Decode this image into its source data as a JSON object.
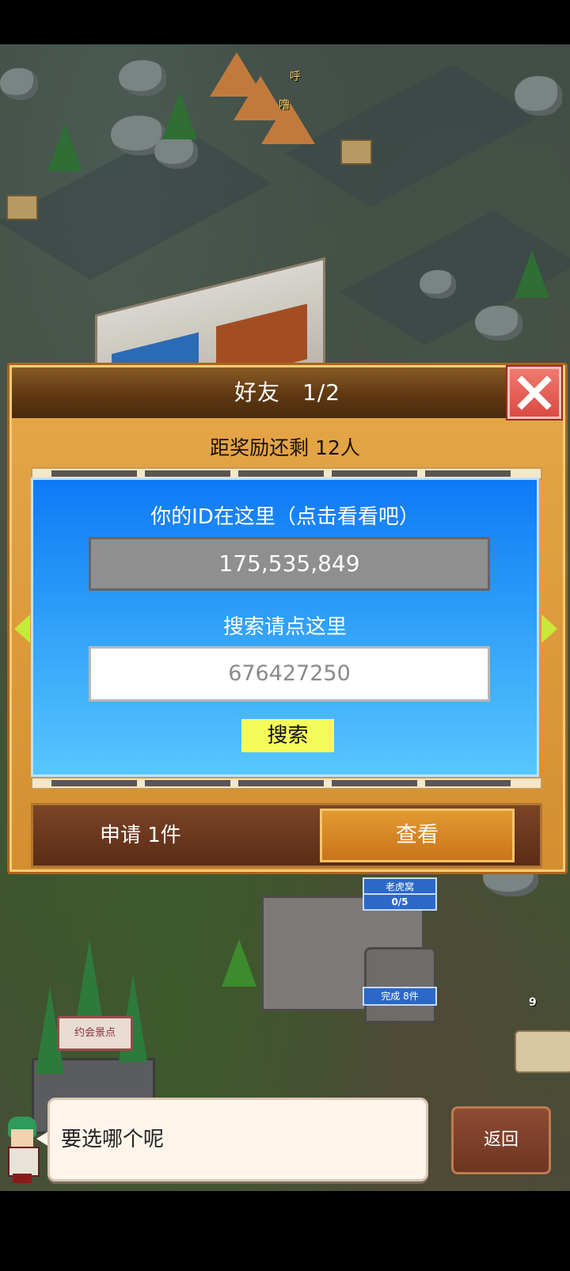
{
  "dialog": {
    "title": "好友",
    "page_indicator": "1/2",
    "reward_text": "距奖励还剩 12人",
    "id_label": "你的ID在这里（点击看看吧）",
    "player_id": "175,535,849",
    "search_label": "搜索请点这里",
    "search_placeholder": "676427250",
    "search_button": "搜索",
    "request_text": "申请 1件",
    "view_button": "查看"
  },
  "map": {
    "bubble_1": "呼",
    "bubble_2": "噜",
    "building_label": "老虎窝",
    "building_counter": "0/5",
    "complete_label": "完成 8件",
    "date_spot_label": "约会景点",
    "ship_badge": "9"
  },
  "message": {
    "text": "要选哪个呢",
    "back_button": "返回"
  },
  "colors": {
    "panel_blue": "#0f79f6",
    "frame_orange": "#d48e2f",
    "close_red": "#d94b42",
    "search_button_yellow": "#f4fb5a"
  },
  "icons": {
    "close": "close-x-icon",
    "prev": "arrow-left-icon",
    "next": "arrow-right-icon"
  }
}
